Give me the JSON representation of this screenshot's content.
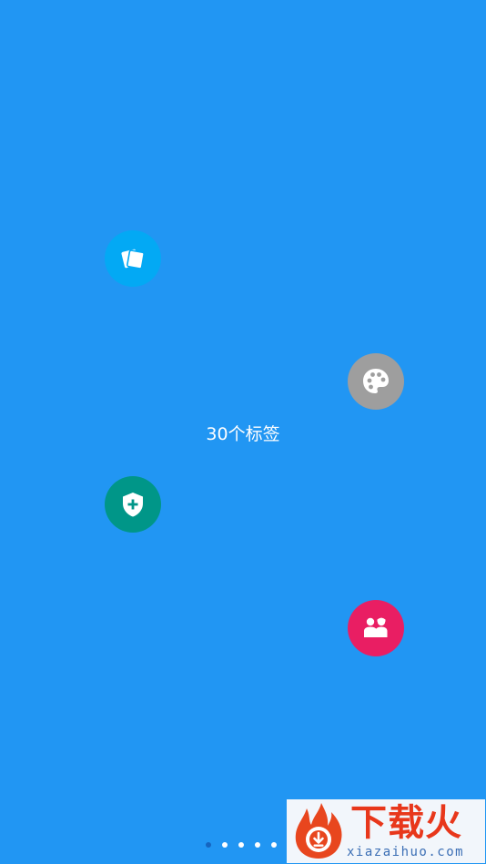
{
  "screen": {
    "center_label": "30个标签",
    "accent_color": "#2196F3",
    "bubbles": [
      {
        "icon": "cards-icon",
        "color": "#03A9F4"
      },
      {
        "icon": "palette-icon",
        "color": "#9E9E9E"
      },
      {
        "icon": "shield-plus-icon",
        "color": "#009688"
      },
      {
        "icon": "people-icon",
        "color": "#E91E63"
      }
    ],
    "pagination": {
      "count": 5,
      "active_index": 0
    }
  },
  "watermark": {
    "brand_text": "下载火",
    "url_text": "xiazaihuo.com"
  }
}
